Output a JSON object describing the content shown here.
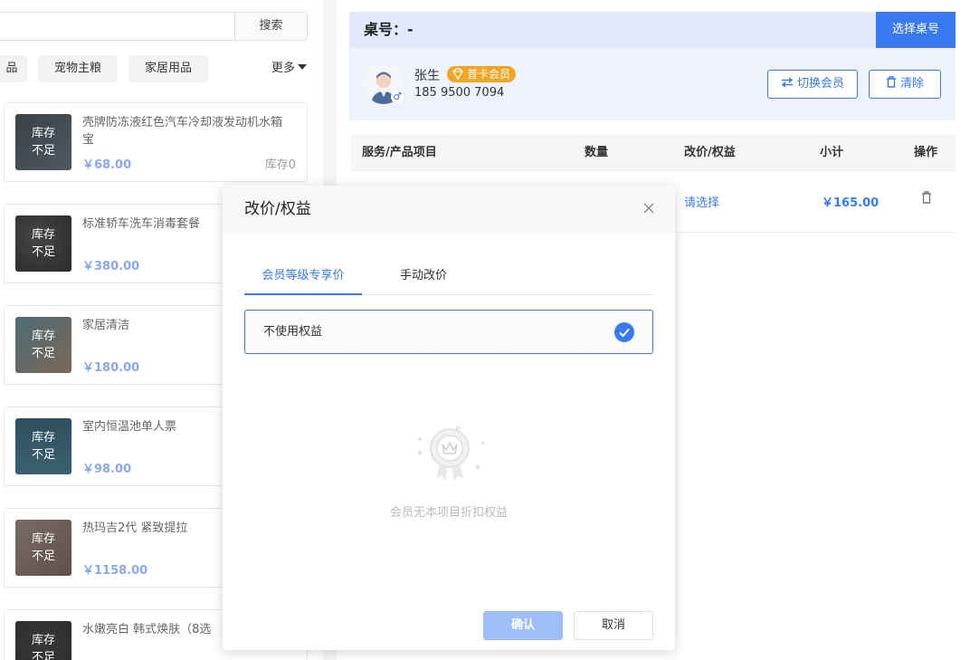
{
  "search": {
    "button_label": "搜索"
  },
  "categories": {
    "items": [
      "品",
      "宠物主粮",
      "家居用品"
    ],
    "more_label": "更多"
  },
  "products": [
    {
      "name": "壳牌防冻液红色汽车冷却液发动机水箱宝",
      "price": "￥68.00",
      "stock": "库存0",
      "badge": "库存\n不足"
    },
    {
      "name": "标准轿车洗车消毒套餐",
      "price": "￥380.00",
      "stock": "",
      "badge": "库存\n不足"
    },
    {
      "name": "家居清洁",
      "price": "￥180.00",
      "stock": "",
      "badge": "库存\n不足"
    },
    {
      "name": "室内恒温池单人票",
      "price": "￥98.00",
      "stock": "",
      "badge": "库存\n不足"
    },
    {
      "name": "热玛吉2代 紧致提拉",
      "price": "￥1158.00",
      "stock": "",
      "badge": "库存\n不足"
    },
    {
      "name": "水嫩亮白 韩式焕肤（8选",
      "price": "",
      "stock": "",
      "badge": "库存\n不足"
    }
  ],
  "badge_lines": [
    "库存",
    "不足"
  ],
  "desk": {
    "title": "桌号：-",
    "select_label": "选择桌号"
  },
  "member": {
    "name": "张生",
    "level": "普卡会员",
    "phone": "185 9500 7094",
    "switch_label": "切换会员",
    "clear_label": "清除"
  },
  "table": {
    "headers": [
      "服务/产品项目",
      "数量",
      "改价/权益",
      "小计",
      "操作"
    ],
    "row": {
      "price_action": "请选择",
      "subtotal": "￥165.00"
    }
  },
  "modal": {
    "title": "改价/权益",
    "tabs": [
      "会员等级专享价",
      "手动改价"
    ],
    "option_label": "不使用权益",
    "empty_text": "会员无本项目折扣权益",
    "confirm_label": "确认",
    "cancel_label": "取消"
  },
  "colors": {
    "primary": "#3a7af0",
    "badge": "#f3a524",
    "price": "#8aa8f0"
  }
}
